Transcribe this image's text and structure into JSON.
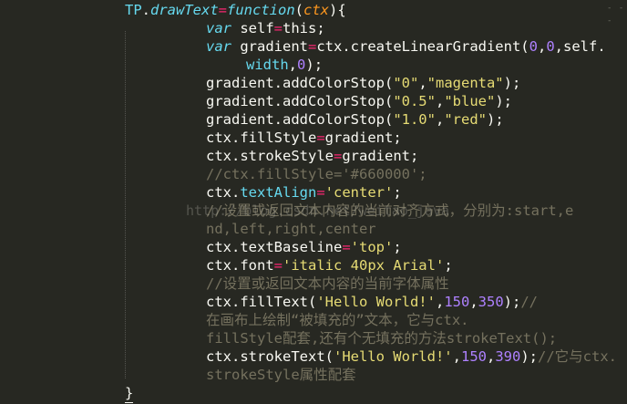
{
  "editor": {
    "watermark": "http://blog.csdn.net/weitao_java",
    "colors": {
      "background": "#272822",
      "keyword": "#66d9ef",
      "operator": "#f92672",
      "number": "#ae81ff",
      "string": "#e6db74",
      "param": "#fd971f",
      "comment": "#75715e",
      "text": "#f8f8f2"
    },
    "lines": [
      [
        [
          "obj",
          "TP"
        ],
        [
          "plain",
          "."
        ],
        [
          "fn",
          "drawText"
        ],
        [
          "op",
          "="
        ],
        [
          "kw",
          "function"
        ],
        [
          "plain",
          "("
        ],
        [
          "param",
          "ctx"
        ],
        [
          "plain",
          "){"
        ]
      ],
      [
        [
          "kw",
          "var"
        ],
        [
          "plain",
          " self"
        ],
        [
          "op",
          "="
        ],
        [
          "plain",
          "this;"
        ]
      ],
      [
        [
          "kw",
          "var"
        ],
        [
          "plain",
          " gradient"
        ],
        [
          "op",
          "="
        ],
        [
          "plain",
          "ctx.createLinearGradient("
        ],
        [
          "num",
          "0"
        ],
        [
          "plain",
          ","
        ],
        [
          "num",
          "0"
        ],
        [
          "plain",
          ",self."
        ]
      ],
      [
        [
          "prop",
          "width"
        ],
        [
          "plain",
          ","
        ],
        [
          "num",
          "0"
        ],
        [
          "plain",
          ");"
        ]
      ],
      [
        [
          "plain",
          "gradient.addColorStop("
        ],
        [
          "str",
          "\"0\""
        ],
        [
          "plain",
          ","
        ],
        [
          "str",
          "\"magenta\""
        ],
        [
          "plain",
          ");"
        ]
      ],
      [
        [
          "plain",
          "gradient.addColorStop("
        ],
        [
          "str",
          "\"0.5\""
        ],
        [
          "plain",
          ","
        ],
        [
          "str",
          "\"blue\""
        ],
        [
          "plain",
          ");"
        ]
      ],
      [
        [
          "plain",
          "gradient.addColorStop("
        ],
        [
          "str",
          "\"1.0\""
        ],
        [
          "plain",
          ","
        ],
        [
          "str",
          "\"red\""
        ],
        [
          "plain",
          ");"
        ]
      ],
      [
        [
          "plain",
          "ctx.fillStyle"
        ],
        [
          "op",
          "="
        ],
        [
          "plain",
          "gradient;"
        ]
      ],
      [
        [
          "plain",
          "ctx.strokeStyle"
        ],
        [
          "op",
          "="
        ],
        [
          "plain",
          "gradient;"
        ]
      ],
      [
        [
          "cmt",
          "//ctx.fillStyle='#660000';"
        ]
      ],
      [
        [
          "plain",
          "ctx."
        ],
        [
          "prop",
          "textAlign"
        ],
        [
          "op",
          "="
        ],
        [
          "str",
          "'center'"
        ],
        [
          "plain",
          ";"
        ]
      ],
      [
        [
          "cmt",
          "//设置或返回文本内容的当前对齐方式，分别为:start,e"
        ]
      ],
      [
        [
          "cmt",
          "nd,left,right,center"
        ]
      ],
      [
        [
          "plain",
          "ctx.textBaseline"
        ],
        [
          "op",
          "="
        ],
        [
          "str",
          "'top'"
        ],
        [
          "plain",
          ";"
        ]
      ],
      [
        [
          "plain",
          "ctx.font"
        ],
        [
          "op",
          "="
        ],
        [
          "str",
          "'italic 40px Arial'"
        ],
        [
          "plain",
          ";"
        ]
      ],
      [
        [
          "cmt",
          "//设置或返回文本内容的当前字体属性"
        ]
      ],
      [
        [
          "plain",
          "ctx.fillText("
        ],
        [
          "str",
          "'Hello World!'"
        ],
        [
          "plain",
          ","
        ],
        [
          "num",
          "150"
        ],
        [
          "plain",
          ","
        ],
        [
          "num",
          "350"
        ],
        [
          "plain",
          ");"
        ],
        [
          "cmt",
          "//"
        ]
      ],
      [
        [
          "cmt",
          "在画布上绘制“被填充的”文本，它与ctx."
        ]
      ],
      [
        [
          "cmt",
          "fillStyle配套,还有个无填充的方法strokeText();"
        ]
      ],
      [
        [
          "plain",
          "ctx.strokeText("
        ],
        [
          "str",
          "'Hello World!'"
        ],
        [
          "plain",
          ","
        ],
        [
          "num",
          "150"
        ],
        [
          "plain",
          ","
        ],
        [
          "num",
          "390"
        ],
        [
          "plain",
          ");"
        ],
        [
          "cmt",
          "//它与ctx."
        ]
      ],
      [
        [
          "cmt",
          "strokeStyle属性配套"
        ]
      ],
      [
        [
          "plain",
          "}"
        ]
      ]
    ]
  }
}
